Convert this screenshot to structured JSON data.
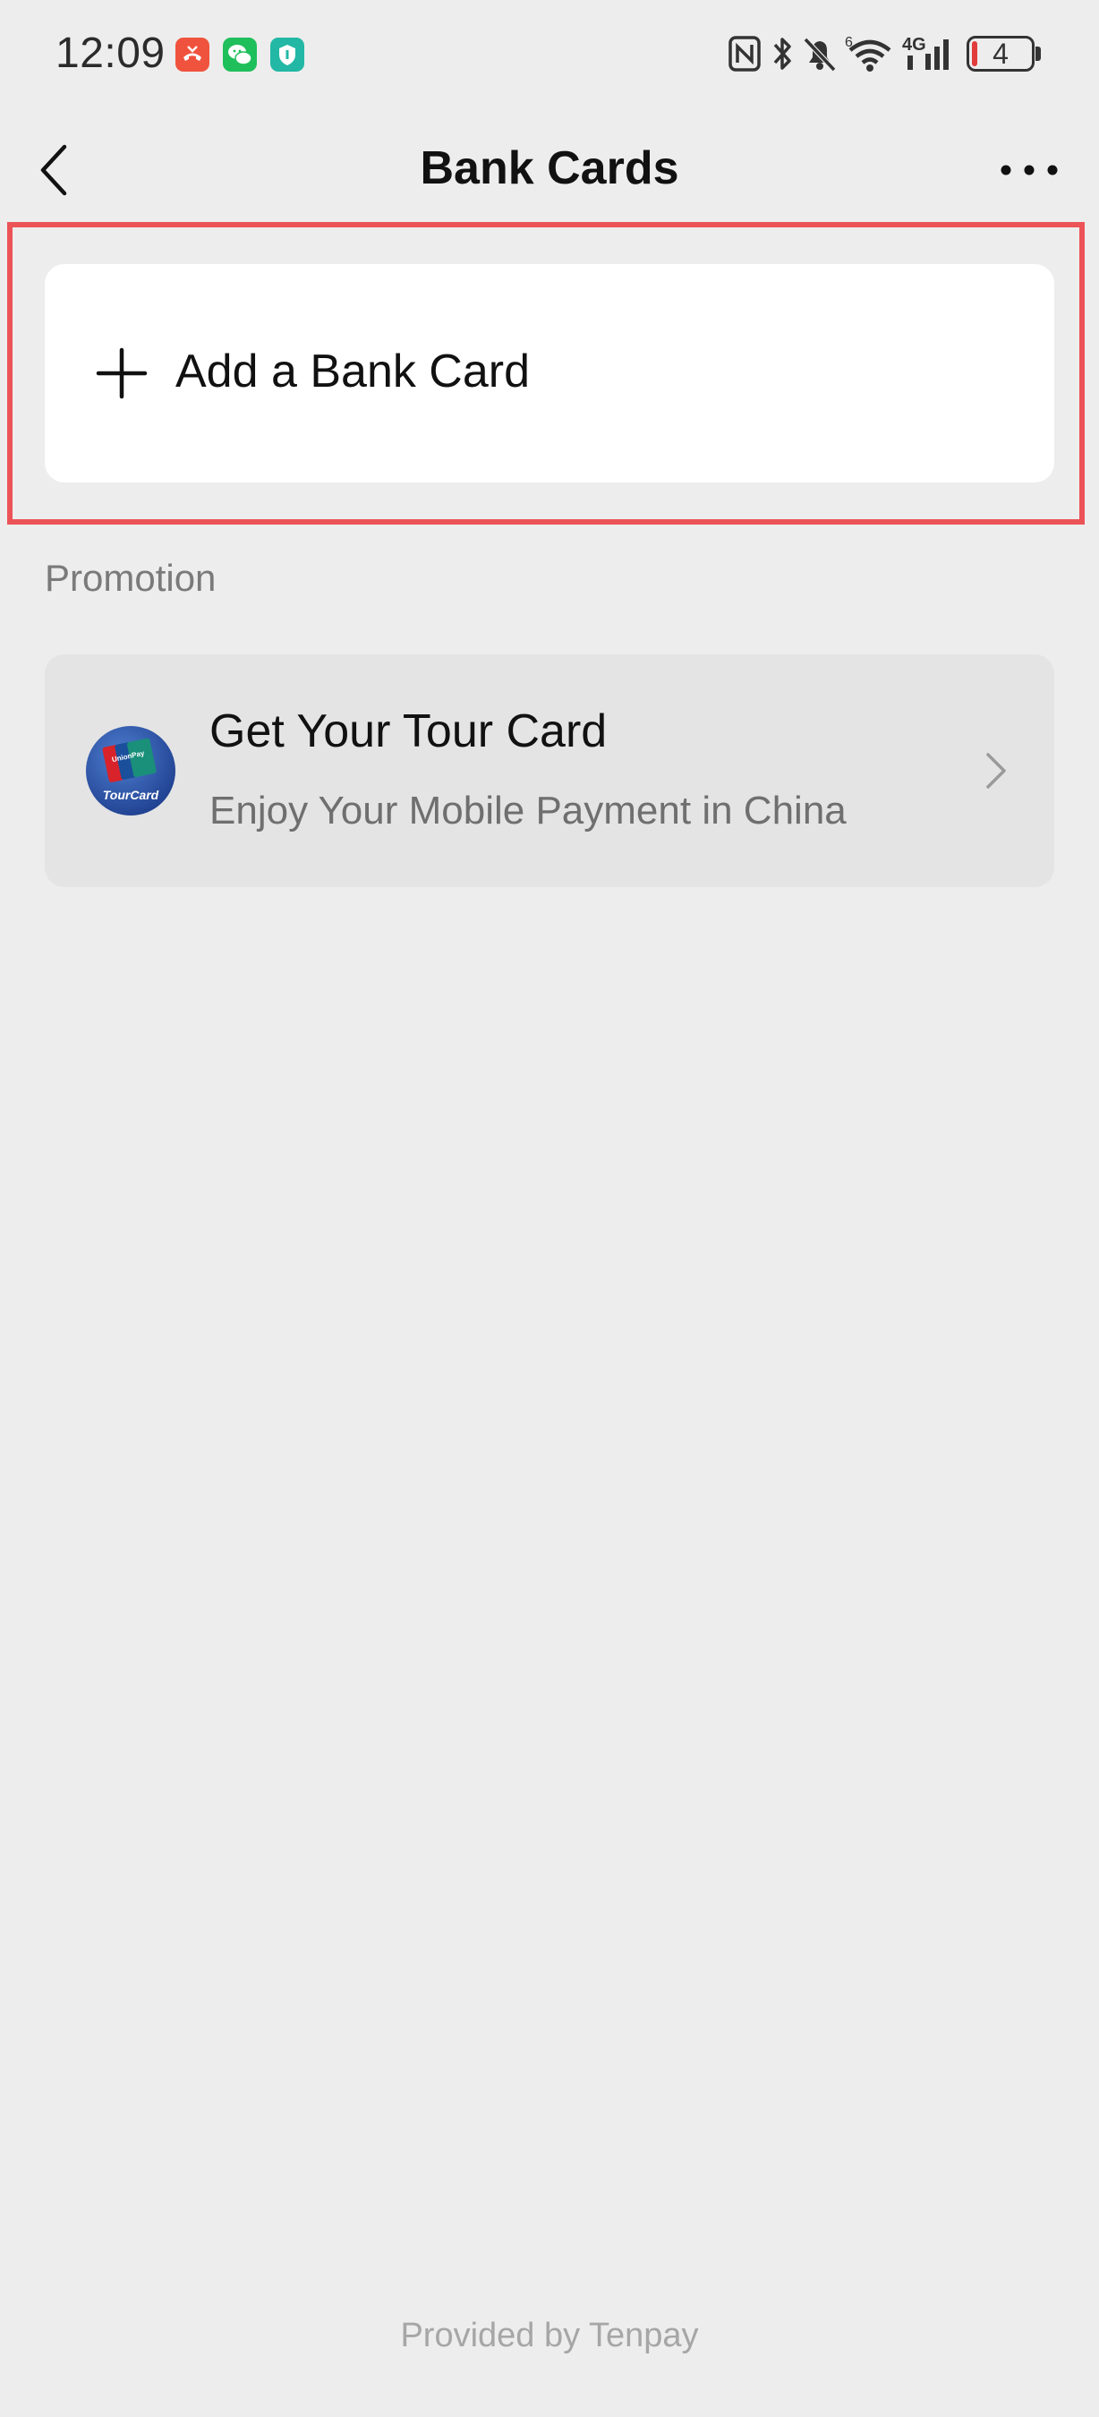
{
  "status_bar": {
    "time": "12:09",
    "battery_level": "4",
    "network": "4G",
    "wifi_badge": "6",
    "notification_icons": [
      "missed-call-icon",
      "wechat-icon",
      "security-shield-icon"
    ],
    "system_icons": [
      "nfc-icon",
      "bluetooth-icon",
      "mute-bell-icon",
      "wifi-icon",
      "signal-icon",
      "battery-icon"
    ]
  },
  "header": {
    "title": "Bank Cards",
    "back_icon": "chevron-left-icon",
    "more_icon": "more-dots-icon"
  },
  "add_card": {
    "label": "Add a Bank Card",
    "icon": "plus-icon"
  },
  "promotion": {
    "section_label": "Promotion",
    "card": {
      "title": "Get Your Tour Card",
      "subtitle": "Enjoy Your Mobile Payment in China",
      "logo_text": "TourCard",
      "logo_brand": "UnionPay",
      "icon": "chevron-right-icon"
    }
  },
  "footer": {
    "text": "Provided by Tenpay"
  },
  "colors": {
    "background": "#ededed",
    "card_background": "#ffffff",
    "promo_background": "#e4e4e4",
    "highlight": "#ec5357",
    "missed_call": "#f0533d",
    "wechat_green": "#1fbf5b",
    "shield_teal": "#22b8a5"
  }
}
